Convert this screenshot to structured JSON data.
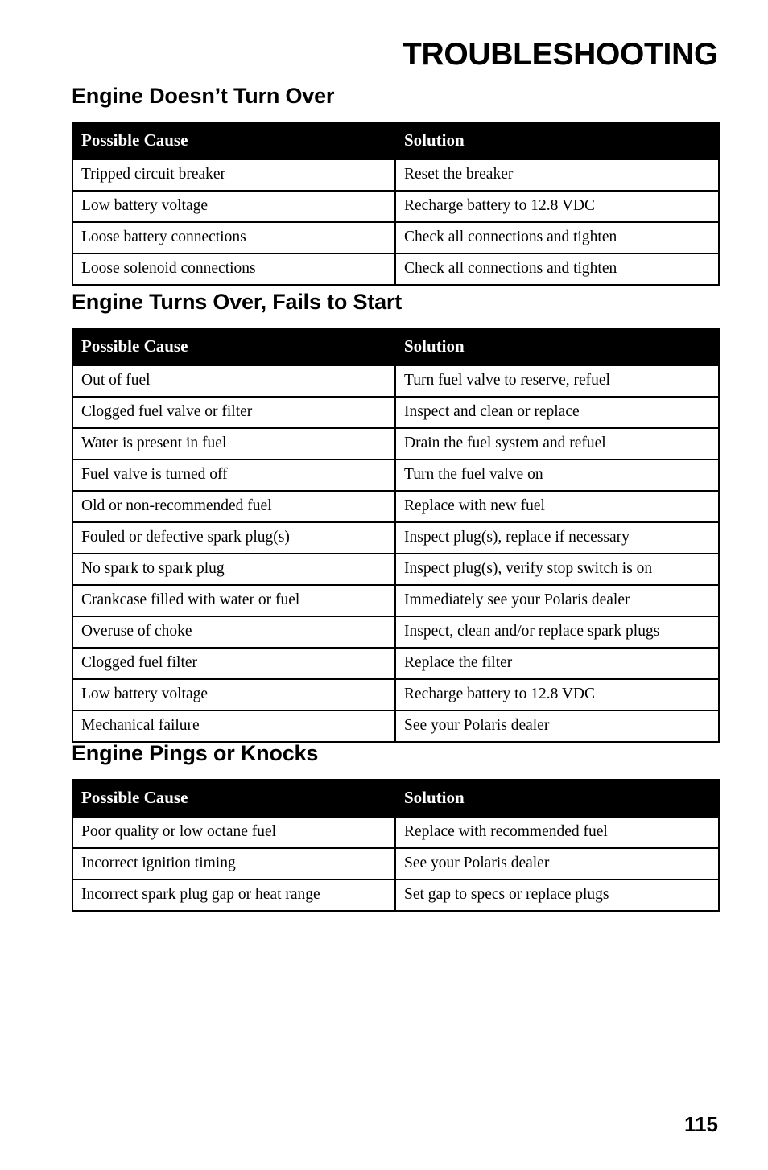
{
  "page": {
    "title": "TROUBLESHOOTING",
    "page_number": "115"
  },
  "column_headers": {
    "cause": "Possible Cause",
    "solution": "Solution"
  },
  "sections": [
    {
      "heading": "Engine Doesn’t Turn Over",
      "headers": [
        "Possible Cause",
        "Solution"
      ],
      "rows": [
        [
          "Tripped circuit breaker",
          "Reset the breaker"
        ],
        [
          "Low battery voltage",
          "Recharge battery to 12.8 VDC"
        ],
        [
          "Loose battery connections",
          "Check all connections and tighten"
        ],
        [
          "Loose solenoid connections",
          "Check all connections and tighten"
        ]
      ]
    },
    {
      "heading": "Engine Turns Over, Fails to Start",
      "headers": [
        "Possible Cause",
        "Solution"
      ],
      "rows": [
        [
          "Out of fuel",
          "Turn fuel valve to reserve, refuel"
        ],
        [
          "Clogged fuel valve or filter",
          "Inspect and clean or replace"
        ],
        [
          "Water is present in fuel",
          "Drain the fuel system and refuel"
        ],
        [
          "Fuel valve is turned off",
          "Turn the fuel valve on"
        ],
        [
          "Old or non-recommended fuel",
          "Replace with new fuel"
        ],
        [
          "Fouled or defective spark plug(s)",
          "Inspect plug(s), replace if necessary"
        ],
        [
          "No spark to spark plug",
          "Inspect plug(s), verify stop switch is on"
        ],
        [
          "Crankcase filled with water or fuel",
          "Immediately see your Polaris dealer"
        ],
        [
          "Overuse of choke",
          "Inspect, clean and/or replace spark plugs"
        ],
        [
          "Clogged fuel filter",
          "Replace the filter"
        ],
        [
          "Low battery voltage",
          "Recharge battery to 12.8 VDC"
        ],
        [
          "Mechanical failure",
          "See your Polaris dealer"
        ]
      ]
    },
    {
      "heading": "Engine Pings or Knocks",
      "headers": [
        "Possible Cause",
        "Solution"
      ],
      "rows": [
        [
          "Poor quality or low octane fuel",
          "Replace with recommended fuel"
        ],
        [
          "Incorrect ignition timing",
          "See your Polaris dealer"
        ],
        [
          "Incorrect spark plug gap or heat range",
          "Set gap to specs or replace plugs"
        ]
      ]
    }
  ]
}
